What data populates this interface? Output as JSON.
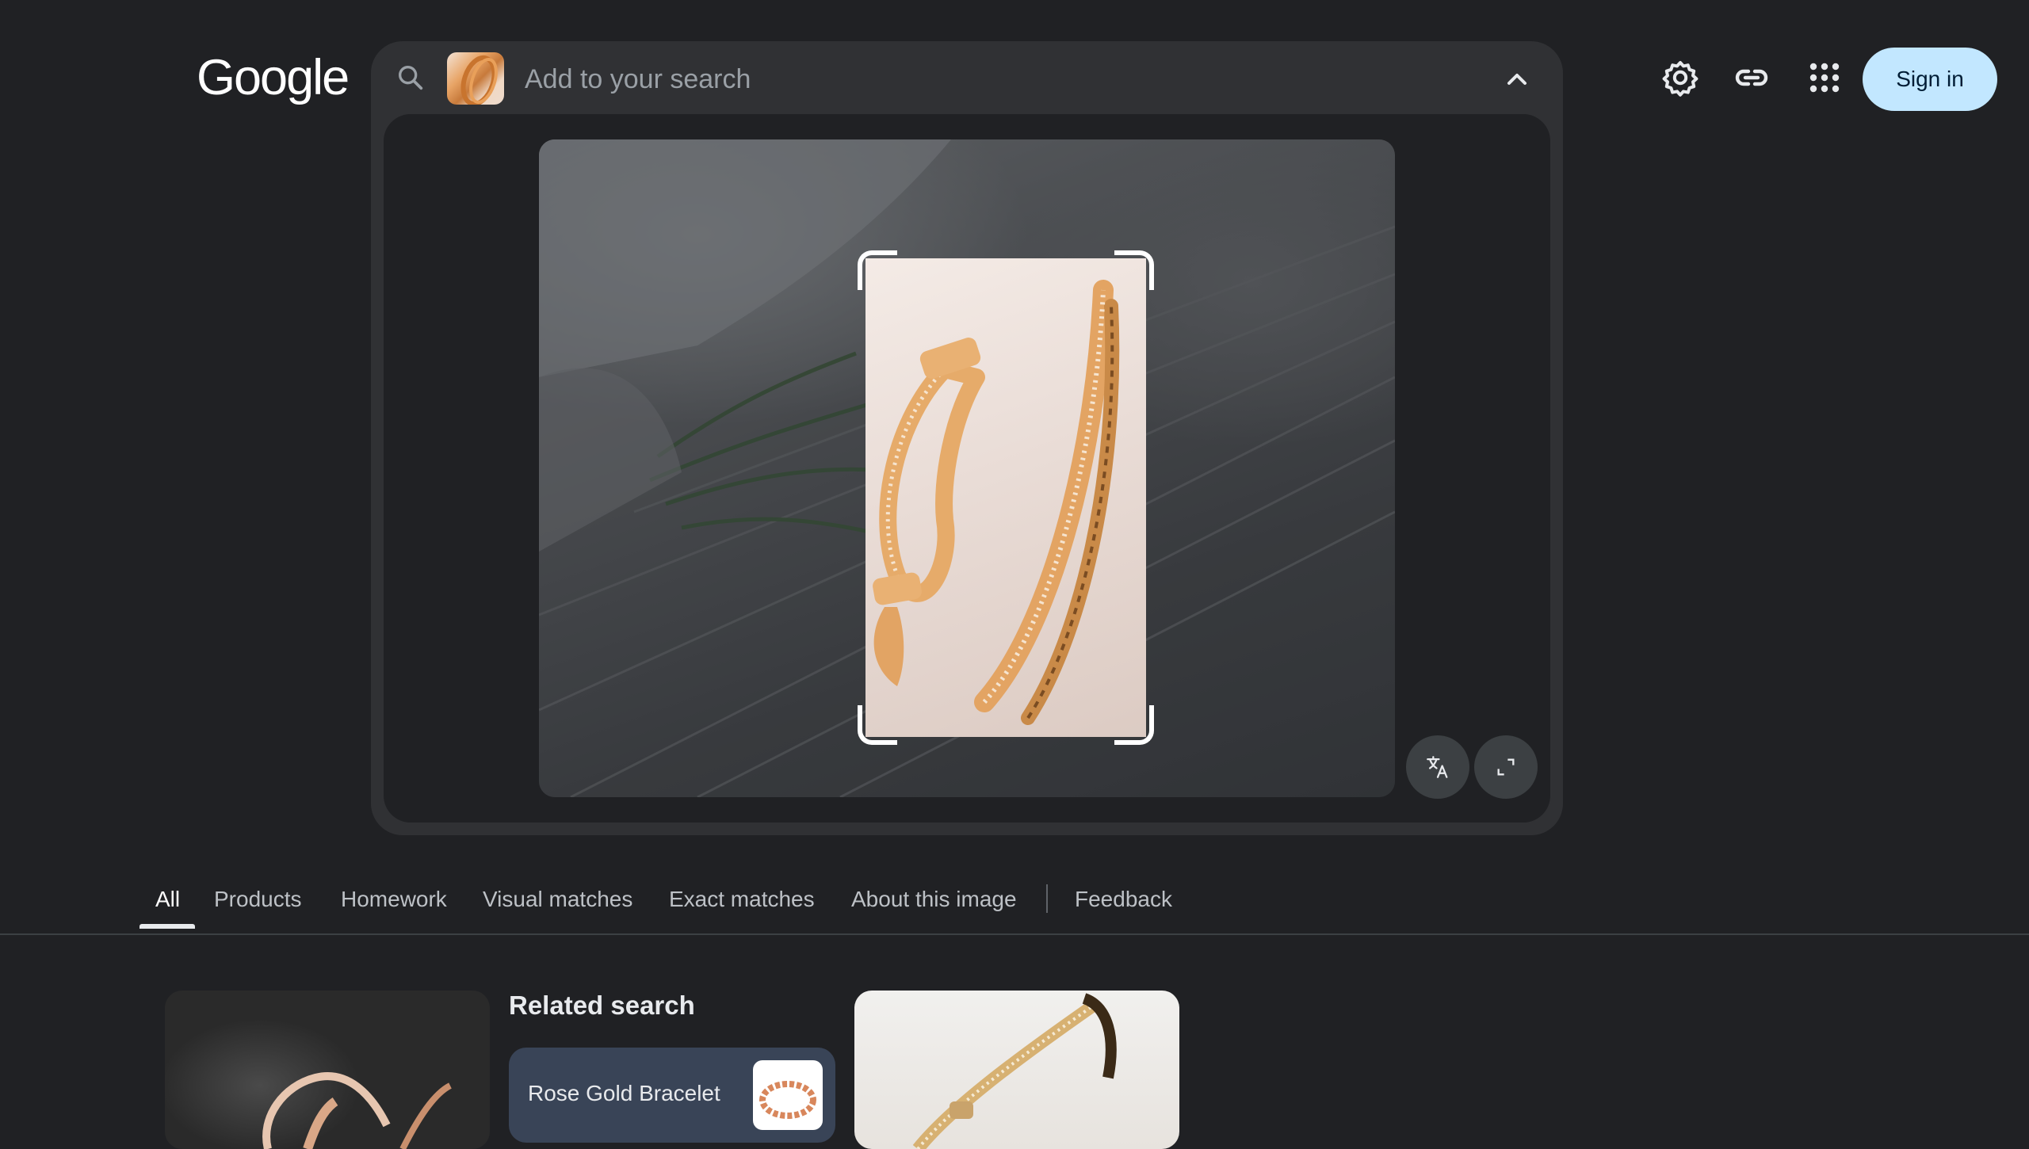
{
  "logo": {
    "text": "Google"
  },
  "search": {
    "placeholder": "Add to your search",
    "query_image": "bracelet-thumbnail",
    "icon": "search-icon",
    "collapse_icon": "chevron-up-icon"
  },
  "image_panel": {
    "translate_button": "translate-icon",
    "fullscreen_button": "expand-icon"
  },
  "header": {
    "settings_icon": "gear-icon",
    "link_icon": "link-icon",
    "apps_icon": "apps-grid-icon",
    "sign_in_label": "Sign in"
  },
  "tabs": [
    {
      "label": "All",
      "active": true
    },
    {
      "label": "Products"
    },
    {
      "label": "Homework"
    },
    {
      "label": "Visual matches"
    },
    {
      "label": "Exact matches"
    },
    {
      "label": "About this image"
    },
    {
      "label": "Feedback"
    }
  ],
  "results": {
    "related_title": "Related search",
    "related_chip": "Rose Gold Bracelet"
  },
  "colors": {
    "background": "#202124",
    "panel": "#303134",
    "sign_in_bg": "#c2e7ff",
    "chip_bg": "#394457"
  }
}
